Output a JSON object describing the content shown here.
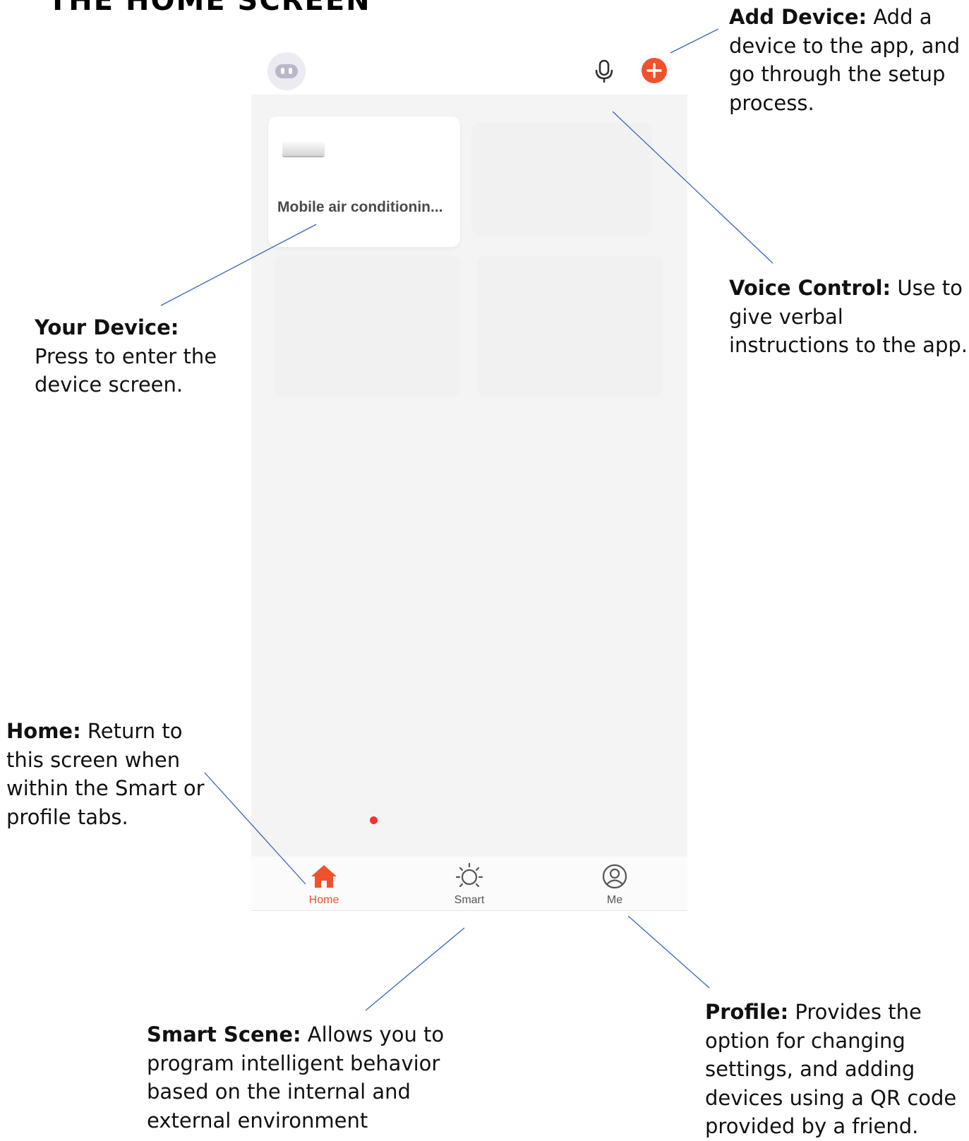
{
  "page_heading": "THE HOME SCREEN",
  "app": {
    "topbar": {
      "avatar_icon": "robot-avatar-icon",
      "voice_icon": "microphone-icon",
      "add_icon": "plus-circle-icon",
      "accent_color": "#f0522b"
    },
    "device_card": {
      "name": "Mobile air conditionin...",
      "image_icon": "air-conditioner-icon"
    },
    "tabs": [
      {
        "label": "Home",
        "icon": "home-icon",
        "active": true
      },
      {
        "label": "Smart",
        "icon": "sun-icon",
        "active": false
      },
      {
        "label": "Me",
        "icon": "profile-icon",
        "active": false,
        "badge": true
      }
    ]
  },
  "callouts": {
    "add_device": {
      "title": "Add Device:",
      "text": " Add a device to the app, and go through the setup process."
    },
    "voice_control": {
      "title": "Voice Control:",
      "text": " Use to give verbal instructions to the app."
    },
    "your_device": {
      "title": "Your Device:",
      "text": "Press to enter the device screen."
    },
    "home": {
      "title": "Home:",
      "text": " Return to this screen when within the Smart or profile tabs."
    },
    "smart_scene": {
      "title": "Smart Scene:",
      "text": " Allows you to program intelligent behavior based on the internal and external environment"
    },
    "profile": {
      "title": "Profile:",
      "text": " Provides the option for changing settings, and adding devices using a QR code provided by a friend."
    }
  },
  "colors": {
    "leader_line": "#3a66b8",
    "screen_bg": "#f4f4f4",
    "badge": "#ee3333"
  }
}
